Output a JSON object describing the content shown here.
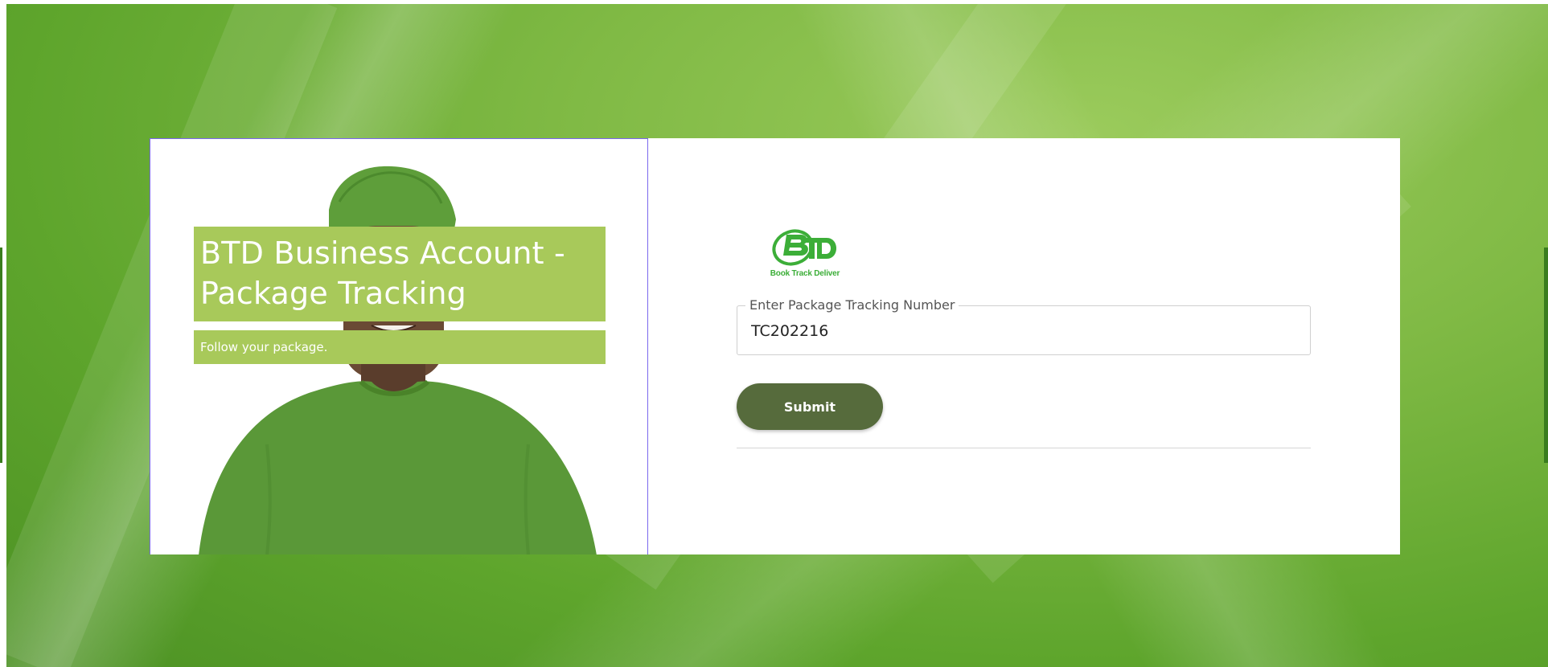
{
  "hero": {
    "title": "BTD Business Account - Package Tracking",
    "subtitle": "Follow your package."
  },
  "logo": {
    "caption": "Book Track Deliver",
    "letters": "BTD"
  },
  "tracking_form": {
    "label": "Enter Package Tracking Number",
    "value": "TC202216",
    "submit_label": "Submit"
  },
  "colors": {
    "brand_green": "#3cae38",
    "button": "#566b3c",
    "banner": "#a8c95a",
    "card_border": "#7b68ee"
  }
}
